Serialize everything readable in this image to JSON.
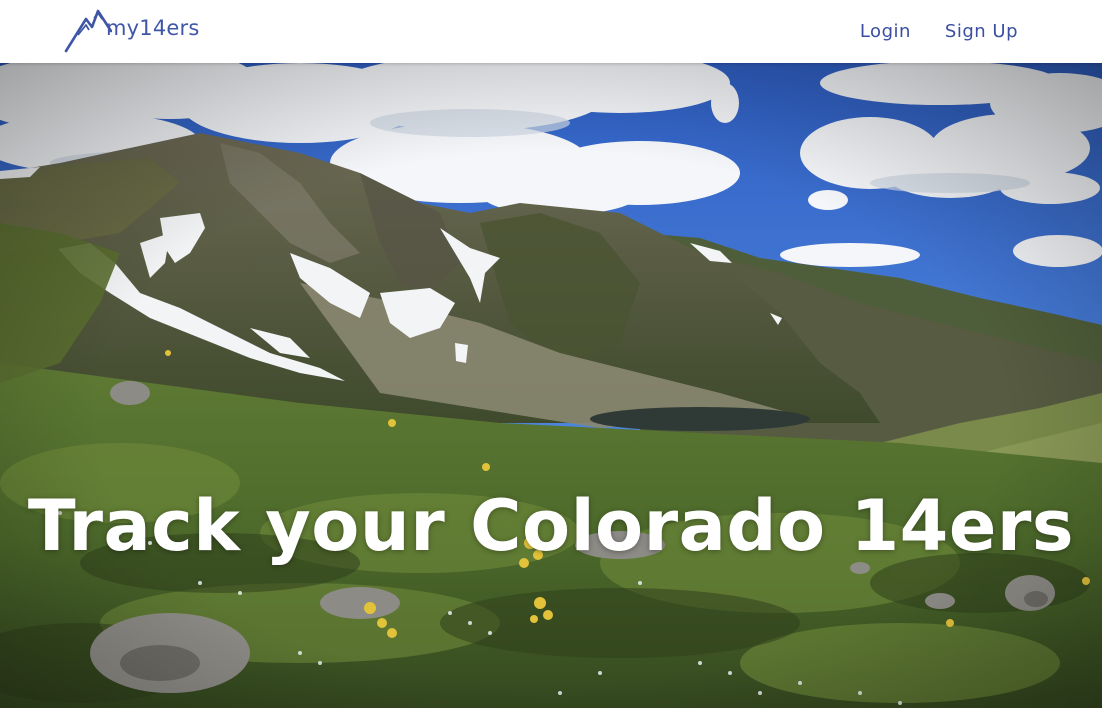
{
  "brand": {
    "name": "my14ers",
    "color": "#4057a8"
  },
  "nav": {
    "login_label": "Login",
    "signup_label": "Sign Up",
    "link_color": "#3a4fa0"
  },
  "hero": {
    "title": "Track your Colorado 14ers",
    "image": "mountain-landscape-photo"
  }
}
